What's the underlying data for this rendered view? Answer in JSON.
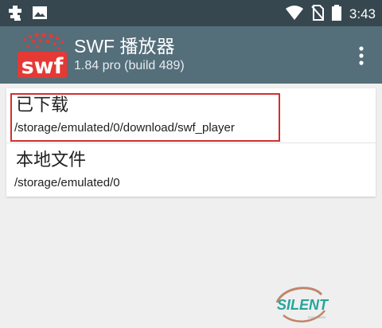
{
  "status_bar": {
    "time": "3:43",
    "icons": [
      "notification-bug-icon",
      "image-icon",
      "wifi-icon",
      "no-sim-icon",
      "battery-icon"
    ]
  },
  "app_bar": {
    "logo_text": "swf",
    "title": "SWF 播放器",
    "subtitle": "1.84 pro (build 489)",
    "overflow_icon": "more-vert-icon"
  },
  "locations": [
    {
      "title": "已下载",
      "path": "/storage/emulated/0/download/swf_player"
    },
    {
      "title": "本地文件",
      "path": "/storage/emulated/0"
    }
  ],
  "watermark": {
    "text": "SILENT",
    "small": "SOFTWARE"
  },
  "colors": {
    "status_bar": "#37474f",
    "app_bar": "#546e7a",
    "logo_red": "#e53935",
    "highlight": "#d32f2f",
    "watermark": "#26a69a"
  }
}
